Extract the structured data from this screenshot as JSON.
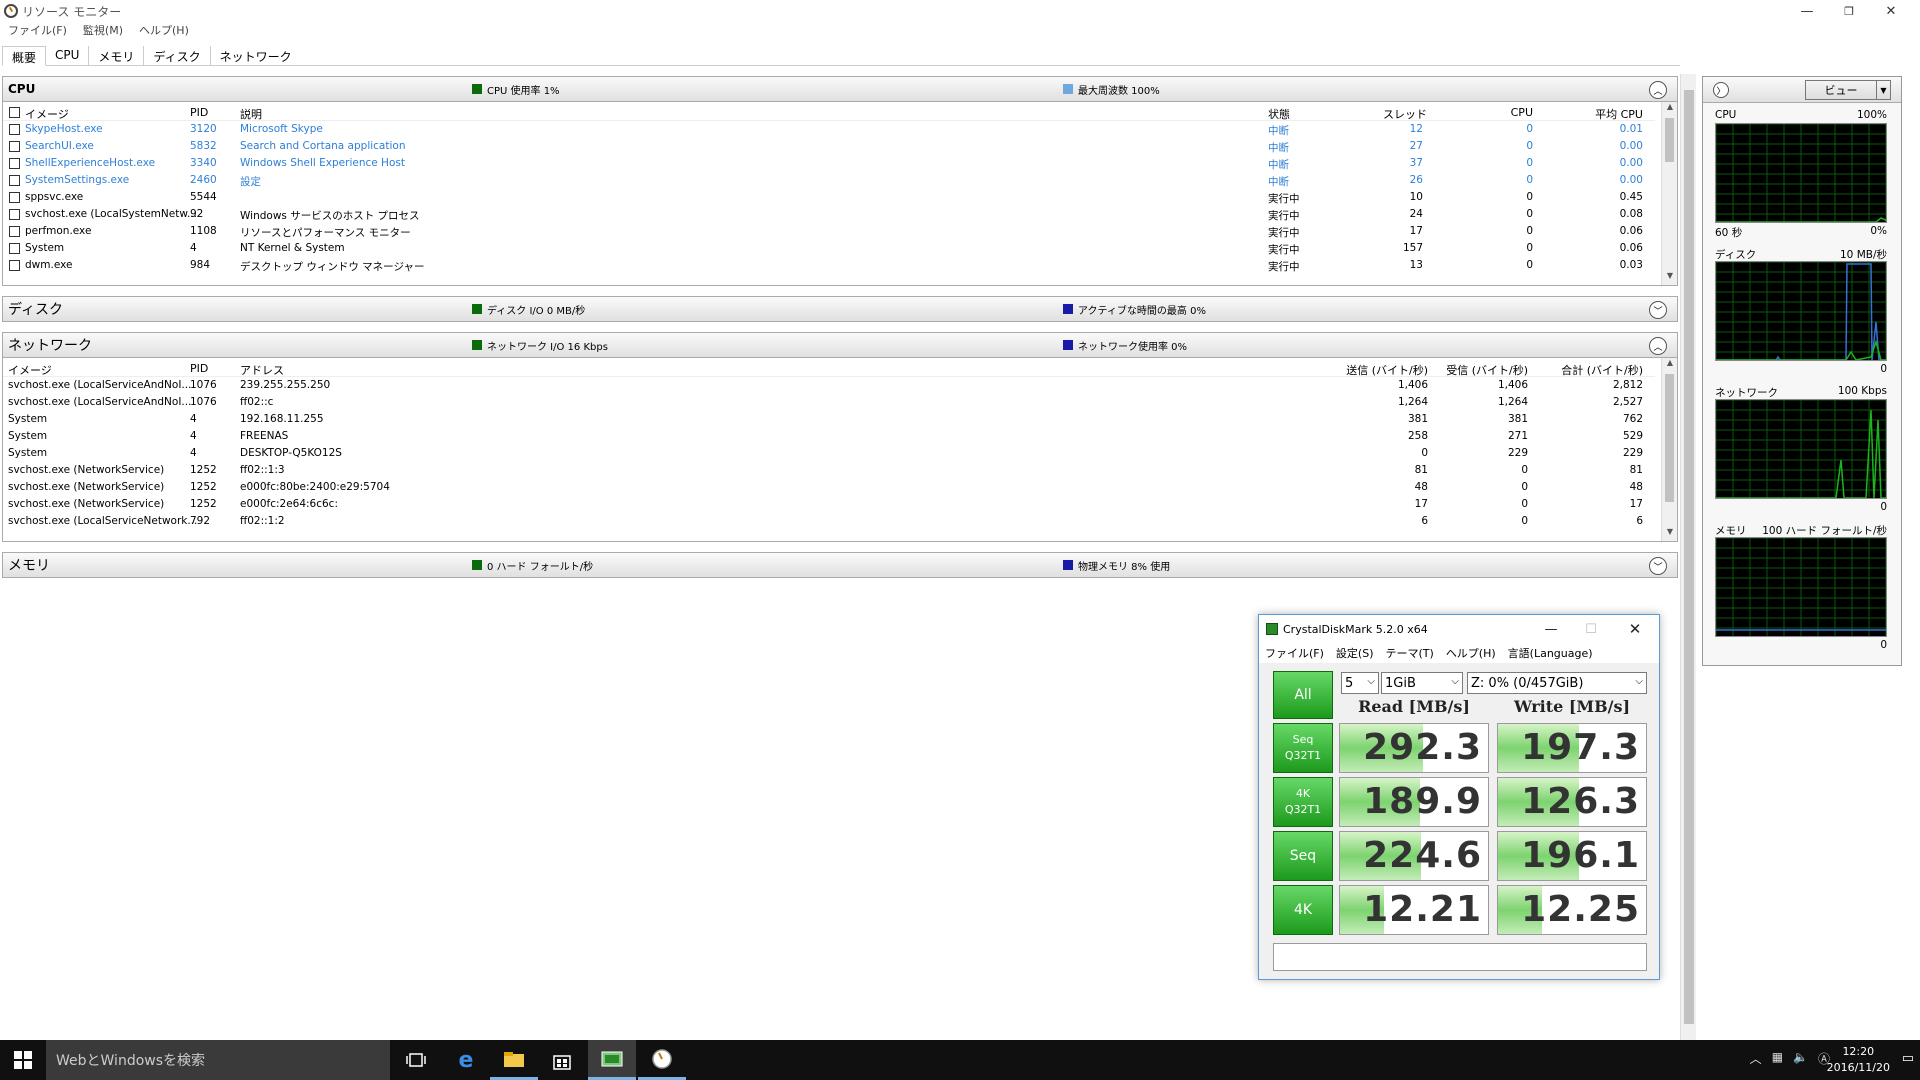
{
  "window": {
    "title": "リソース モニター",
    "menus": [
      "ファイル(F)",
      "監視(M)",
      "ヘルプ(H)"
    ],
    "tabs": [
      "概要",
      "CPU",
      "メモリ",
      "ディスク",
      "ネットワーク"
    ]
  },
  "cpu": {
    "title": "CPU",
    "metric1": "CPU 使用率 1%",
    "metric1_color": "#0a6b0a",
    "metric2": "最大周波数 100%",
    "metric2_color": "#6fa8dc",
    "headers": [
      "イメージ",
      "PID",
      "説明",
      "状態",
      "スレッド",
      "CPU",
      "平均 CPU"
    ],
    "rows": [
      {
        "image": "SkypeHost.exe",
        "pid": "3120",
        "desc": "Microsoft Skype",
        "state": "中断",
        "threads": "12",
        "cpu": "0",
        "avg": "0.01",
        "suspended": true
      },
      {
        "image": "SearchUI.exe",
        "pid": "5832",
        "desc": "Search and Cortana application",
        "state": "中断",
        "threads": "27",
        "cpu": "0",
        "avg": "0.00",
        "suspended": true
      },
      {
        "image": "ShellExperienceHost.exe",
        "pid": "3340",
        "desc": "Windows Shell Experience Host",
        "state": "中断",
        "threads": "37",
        "cpu": "0",
        "avg": "0.00",
        "suspended": true
      },
      {
        "image": "SystemSettings.exe",
        "pid": "2460",
        "desc": "設定",
        "state": "中断",
        "threads": "26",
        "cpu": "0",
        "avg": "0.00",
        "suspended": true
      },
      {
        "image": "sppsvc.exe",
        "pid": "5544",
        "desc": "",
        "state": "実行中",
        "threads": "10",
        "cpu": "0",
        "avg": "0.45",
        "suspended": false
      },
      {
        "image": "svchost.exe (LocalSystemNetw...",
        "pid": "92",
        "desc": "Windows サービスのホスト プロセス",
        "state": "実行中",
        "threads": "24",
        "cpu": "0",
        "avg": "0.08",
        "suspended": false
      },
      {
        "image": "perfmon.exe",
        "pid": "1108",
        "desc": "リソースとパフォーマンス モニター",
        "state": "実行中",
        "threads": "17",
        "cpu": "0",
        "avg": "0.06",
        "suspended": false
      },
      {
        "image": "System",
        "pid": "4",
        "desc": "NT Kernel & System",
        "state": "実行中",
        "threads": "157",
        "cpu": "0",
        "avg": "0.06",
        "suspended": false
      },
      {
        "image": "dwm.exe",
        "pid": "984",
        "desc": "デスクトップ ウィンドウ マネージャー",
        "state": "実行中",
        "threads": "13",
        "cpu": "0",
        "avg": "0.03",
        "suspended": false
      }
    ]
  },
  "disk": {
    "title": "ディスク",
    "metric1": "ディスク I/O 0 MB/秒",
    "metric1_color": "#0a6b0a",
    "metric2": "アクティブな時間の最高 0%",
    "metric2_color": "#1a1aa8"
  },
  "network": {
    "title": "ネットワーク",
    "metric1": "ネットワーク I/O 16 Kbps",
    "metric1_color": "#0a6b0a",
    "metric2": "ネットワーク使用率 0%",
    "metric2_color": "#1a1aa8",
    "headers": [
      "イメージ",
      "PID",
      "アドレス",
      "送信 (バイト/秒)",
      "受信 (バイト/秒)",
      "合計 (バイト/秒)"
    ],
    "rows": [
      {
        "image": "svchost.exe (LocalServiceAndNoI...",
        "pid": "1076",
        "addr": "239.255.255.250",
        "send": "1,406",
        "recv": "1,406",
        "total": "2,812"
      },
      {
        "image": "svchost.exe (LocalServiceAndNoI...",
        "pid": "1076",
        "addr": "ff02::c",
        "send": "1,264",
        "recv": "1,264",
        "total": "2,527"
      },
      {
        "image": "System",
        "pid": "4",
        "addr": "192.168.11.255",
        "send": "381",
        "recv": "381",
        "total": "762"
      },
      {
        "image": "System",
        "pid": "4",
        "addr": "FREENAS",
        "send": "258",
        "recv": "271",
        "total": "529"
      },
      {
        "image": "System",
        "pid": "4",
        "addr": "DESKTOP-Q5KO12S",
        "send": "0",
        "recv": "229",
        "total": "229"
      },
      {
        "image": "svchost.exe (NetworkService)",
        "pid": "1252",
        "addr": "ff02::1:3",
        "send": "81",
        "recv": "0",
        "total": "81"
      },
      {
        "image": "svchost.exe (NetworkService)",
        "pid": "1252",
        "addr": "e000fc:80be:2400:e29:5704",
        "send": "48",
        "recv": "0",
        "total": "48"
      },
      {
        "image": "svchost.exe (NetworkService)",
        "pid": "1252",
        "addr": "e000fc:2e64:6c6c:",
        "send": "17",
        "recv": "0",
        "total": "17"
      },
      {
        "image": "svchost.exe (LocalServiceNetwork...",
        "pid": "792",
        "addr": "ff02::1:2",
        "send": "6",
        "recv": "0",
        "total": "6"
      }
    ]
  },
  "memory": {
    "title": "メモリ",
    "metric1": "0 ハード フォールト/秒",
    "metric1_color": "#0a6b0a",
    "metric2": "物理メモリ 8% 使用",
    "metric2_color": "#1a1aa8"
  },
  "right_panel": {
    "view_label": "ビュー",
    "graphs": [
      {
        "name": "CPU",
        "max": "100%",
        "min_left": "60 秒",
        "min_right": "0%"
      },
      {
        "name": "ディスク",
        "max": "10 MB/秒",
        "min_left": "",
        "min_right": "0"
      },
      {
        "name": "ネットワーク",
        "max": "100 Kbps",
        "min_left": "",
        "min_right": "0"
      },
      {
        "name": "メモリ",
        "max": "100 ハード フォールト/秒",
        "min_left": "",
        "min_right": "0"
      }
    ]
  },
  "cdm": {
    "title": "CrystalDiskMark 5.2.0 x64",
    "menus": [
      "ファイル(F)",
      "設定(S)",
      "テーマ(T)",
      "ヘルプ(H)",
      "言語(Language)"
    ],
    "all_label": "All",
    "count": "5",
    "size": "1GiB",
    "drive": "Z: 0% (0/457GiB)",
    "read_header": "Read [MB/s]",
    "write_header": "Write [MB/s]",
    "tests": [
      {
        "line1": "Seq",
        "line2": "Q32T1",
        "read": "292.3",
        "write": "197.3",
        "read_fill": 0.56,
        "write_fill": 0.55
      },
      {
        "line1": "4K",
        "line2": "Q32T1",
        "read": "189.9",
        "write": "126.3",
        "read_fill": 0.54,
        "write_fill": 0.55
      },
      {
        "line1": "Seq",
        "line2": "",
        "read": "224.6",
        "write": "196.1",
        "read_fill": 0.55,
        "write_fill": 0.55
      },
      {
        "line1": "4K",
        "line2": "",
        "read": "12.21",
        "write": "12.25",
        "read_fill": 0.3,
        "write_fill": 0.3
      }
    ]
  },
  "taskbar": {
    "search_placeholder": "WebとWindowsを検索",
    "time": "12:20",
    "date": "2016/11/20"
  }
}
